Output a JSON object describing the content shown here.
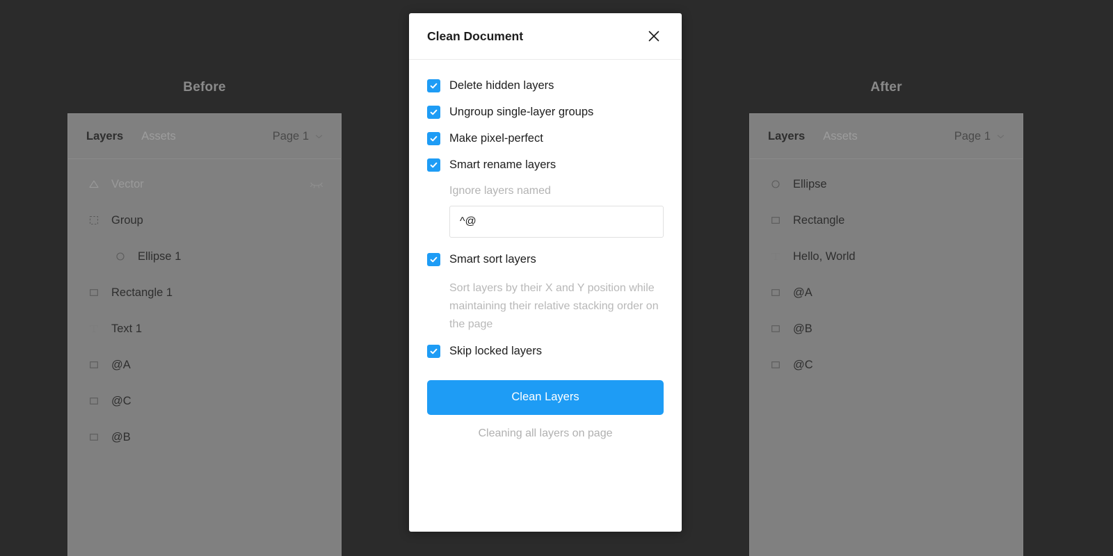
{
  "sections": {
    "before_label": "Before",
    "after_label": "After"
  },
  "panel_before": {
    "tabs": [
      {
        "label": "Layers",
        "active": true
      },
      {
        "label": "Assets",
        "active": false
      }
    ],
    "page_selector": {
      "label": "Page 1",
      "icon": "chevron-down-icon"
    },
    "layers": [
      {
        "name": "Vector",
        "icon": "triangle-icon",
        "indent": 0,
        "hidden": true,
        "visibility_icon": "eye-closed-icon"
      },
      {
        "name": "Group",
        "icon": "dashed-square-icon",
        "indent": 0,
        "hidden": false
      },
      {
        "name": "Ellipse 1",
        "icon": "circle-icon",
        "indent": 1,
        "hidden": false
      },
      {
        "name": "Rectangle 1",
        "icon": "square-icon",
        "indent": 0,
        "hidden": false
      },
      {
        "name": "Text 1",
        "icon": "text-t-icon",
        "indent": 0,
        "hidden": false
      },
      {
        "name": "@A",
        "icon": "square-icon",
        "indent": 0,
        "hidden": false
      },
      {
        "name": "@C",
        "icon": "square-icon",
        "indent": 0,
        "hidden": false
      },
      {
        "name": "@B",
        "icon": "square-icon",
        "indent": 0,
        "hidden": false
      }
    ]
  },
  "panel_after": {
    "tabs": [
      {
        "label": "Layers",
        "active": true
      },
      {
        "label": "Assets",
        "active": false
      }
    ],
    "page_selector": {
      "label": "Page 1",
      "icon": "chevron-down-icon"
    },
    "layers": [
      {
        "name": "Ellipse",
        "icon": "circle-icon",
        "indent": 0,
        "hidden": false
      },
      {
        "name": "Rectangle",
        "icon": "square-icon",
        "indent": 0,
        "hidden": false
      },
      {
        "name": "Hello, World",
        "icon": "text-t-icon",
        "indent": 0,
        "hidden": false
      },
      {
        "name": "@A",
        "icon": "square-icon",
        "indent": 0,
        "hidden": false
      },
      {
        "name": "@B",
        "icon": "square-icon",
        "indent": 0,
        "hidden": false
      },
      {
        "name": "@C",
        "icon": "square-icon",
        "indent": 0,
        "hidden": false
      }
    ]
  },
  "modal": {
    "title": "Clean Document",
    "close_icon": "close-icon",
    "options": {
      "delete_hidden": {
        "label": "Delete hidden layers",
        "checked": true
      },
      "ungroup_single": {
        "label": "Ungroup single-layer groups",
        "checked": true
      },
      "pixel_perfect": {
        "label": "Make pixel-perfect",
        "checked": true
      },
      "smart_rename": {
        "label": "Smart rename layers",
        "checked": true
      },
      "smart_sort": {
        "label": "Smart sort layers",
        "checked": true
      },
      "skip_locked": {
        "label": "Skip locked layers",
        "checked": true
      }
    },
    "ignore_field": {
      "label": "Ignore layers named",
      "value": "^@",
      "placeholder": "^@"
    },
    "sort_description": "Sort layers by their X and Y position while maintaining their relative stacking order on the page",
    "primary_button": "Clean Layers",
    "footnote": "Cleaning all layers on page"
  },
  "colors": {
    "accent": "#1e9cf5",
    "app_background": "#2b2b2b",
    "panel_background": "#808080",
    "modal_background": "#ffffff"
  }
}
